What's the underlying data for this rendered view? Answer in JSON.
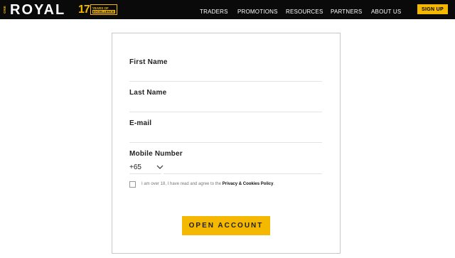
{
  "header": {
    "logo_prefix": "ONE",
    "logo_text": "ROYAL",
    "badge_number": "17",
    "badge_line1": "YEARS OF",
    "badge_line2": "EXCELLENCE",
    "nav": [
      "TRADERS",
      "PROMOTIONS",
      "RESOURCES",
      "PARTNERS",
      "ABOUT US"
    ],
    "signup_label": "SIGN UP"
  },
  "form": {
    "first_name_label": "First Name",
    "first_name_value": "",
    "last_name_label": "Last Name",
    "last_name_value": "",
    "email_label": "E-mail",
    "email_value": "",
    "mobile_label": "Mobile Number",
    "country_code": "+65",
    "mobile_value": "",
    "consent_prefix": "I am over 18, I have read and agree to the ",
    "consent_link": "Privacy & Cookies Policy",
    "consent_suffix": ".",
    "consent_checked": false,
    "submit_label": "OPEN ACCOUNT"
  },
  "colors": {
    "brand_yellow": "#f5b800",
    "header_bg": "#0a0a0a"
  }
}
